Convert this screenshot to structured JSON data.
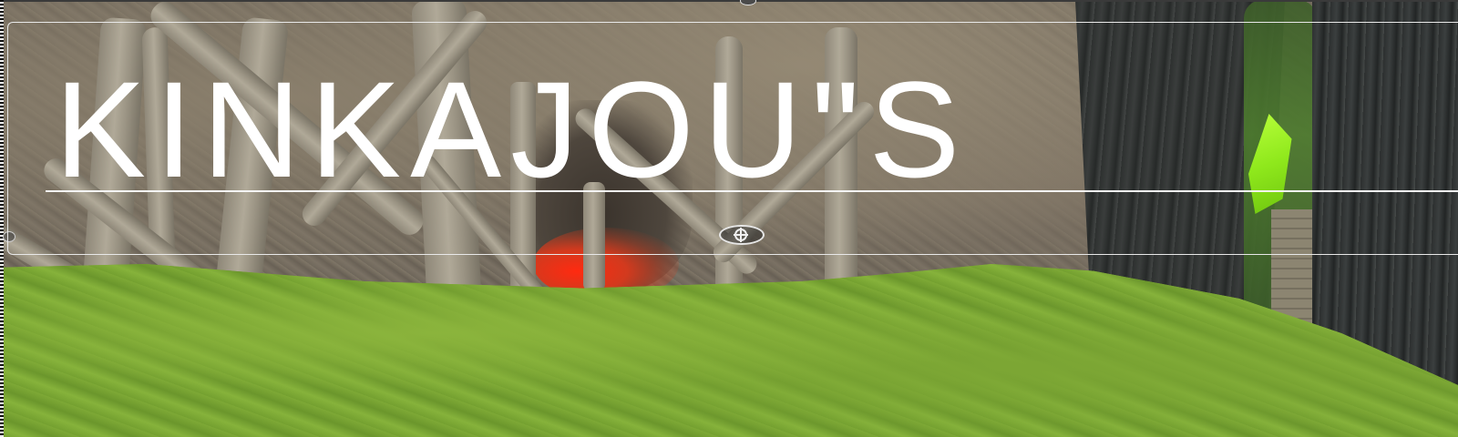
{
  "scene": {
    "title_text": "KINKAJOU\"S",
    "colors": {
      "title": "#ffffff",
      "grass": "#78a533",
      "rock": "#73695c",
      "gem": "#8fe81c",
      "lava": "#ff2a10",
      "trunk": "#2d302f"
    },
    "icons": {
      "pivot_handle": "move-pivot-icon",
      "top_handle": "rotate-handle-icon",
      "left_handle": "resize-handle-icon",
      "gem": "green-gem-icon"
    }
  }
}
